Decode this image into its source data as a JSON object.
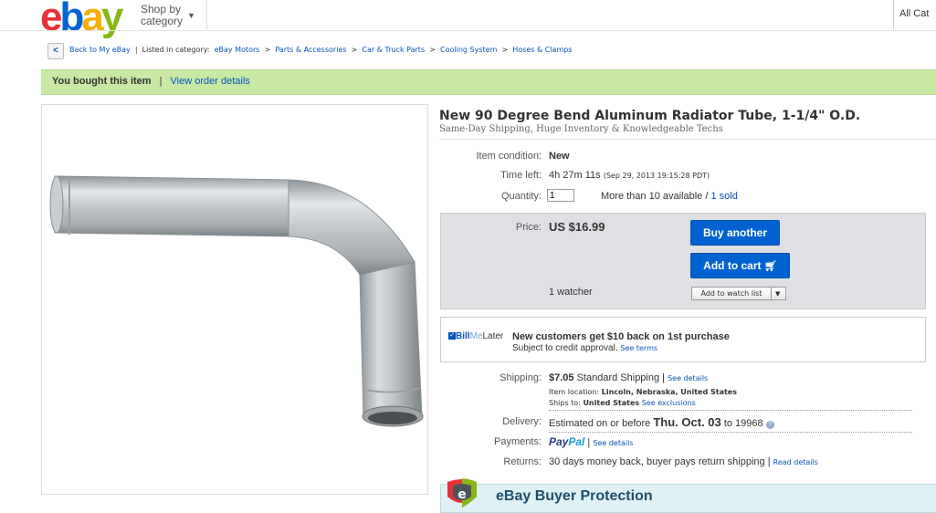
{
  "header": {
    "logo": {
      "e": "e",
      "b": "b",
      "a": "a",
      "y": "y"
    },
    "shop_by": "Shop by",
    "category": "category",
    "all_categories": "All Cat"
  },
  "breadcrumb": {
    "back": "Back to My eBay",
    "listed_in": "Listed in category:",
    "items": [
      "eBay Motors",
      "Parts & Accessories",
      "Car & Truck Parts",
      "Cooling System",
      "Hoses & Clamps"
    ]
  },
  "bought_bar": {
    "message": "You bought this item",
    "separator": "|",
    "link": "View order details"
  },
  "product": {
    "title": "New 90 Degree Bend Aluminum Radiator Tube, 1-1/4\" O.D.",
    "subtitle": "Same-Day Shipping, Huge Inventory & Knowledgeable Techs",
    "image_alt": "aluminum-radiator-tube-image"
  },
  "details": {
    "condition_label": "Item condition:",
    "condition_value": "New",
    "time_left_label": "Time left:",
    "time_left_value": "4h 27m 11s",
    "time_left_date": "(Sep 29, 2013  19:15:28 PDT)",
    "quantity_label": "Quantity:",
    "quantity_value": "1",
    "available": "More than 10 available /",
    "sold": "1 sold"
  },
  "price_box": {
    "price_label": "Price:",
    "price_value": "US $16.99",
    "buy_another": "Buy another",
    "add_to_cart": "Add to cart",
    "watchers": "1 watcher",
    "add_to_watch": "Add to watch list"
  },
  "bill_me_later": {
    "brand_bill": "Bill",
    "brand_me": "Me",
    "brand_later": "Later",
    "headline": "New customers get $10 back on 1st purchase",
    "subline": "Subject to credit approval.",
    "see_terms": "See terms"
  },
  "shipping": {
    "label": "Shipping:",
    "cost": "$7.05",
    "method": "Standard Shipping",
    "see_details": "See details",
    "location_label": "Item location:",
    "location": "Lincoln, Nebraska, United States",
    "ships_to_label": "Ships to:",
    "ships_to": "United States",
    "see_exclusions": "See exclusions"
  },
  "delivery": {
    "label": "Delivery:",
    "prefix": "Estimated on or before",
    "date": "Thu. Oct. 03",
    "to": "to 19968"
  },
  "payments": {
    "label": "Payments:",
    "paypal": "PayPal",
    "see_details": "See details"
  },
  "returns": {
    "label": "Returns:",
    "value": "30 days money back, buyer pays return shipping",
    "read_details": "Read details"
  },
  "protection": {
    "title": "eBay Buyer Protection"
  },
  "colors": {
    "ebay_red": "#e53238",
    "ebay_blue": "#0064d2",
    "ebay_yellow": "#f5af02",
    "ebay_green": "#86b817",
    "button_blue": "#0062d1",
    "bought_bar": "#c8e8a4"
  }
}
